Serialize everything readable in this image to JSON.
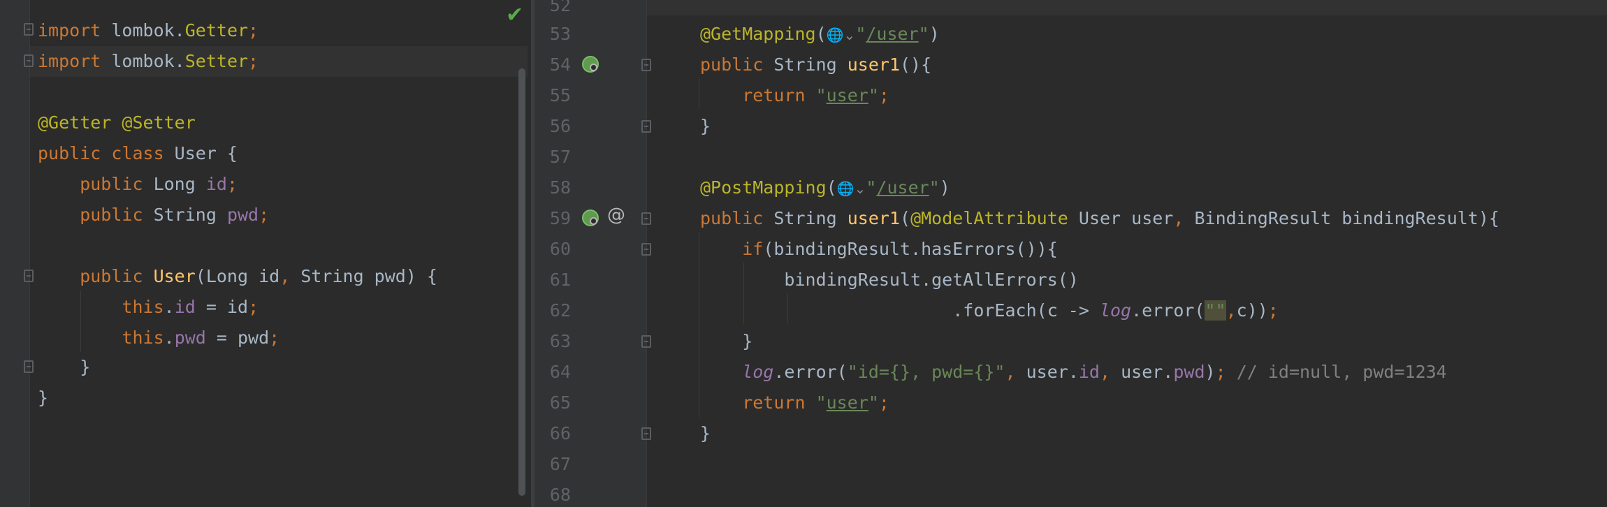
{
  "left_editor": {
    "lines": {
      "l1_kw": "import",
      "l1_pkg": " lombok.",
      "l1_cls": "Getter",
      "l1_semi": ";",
      "l2_kw": "import",
      "l2_pkg": " lombok.",
      "l2_cls": "Setter",
      "l2_semi": ";",
      "l4_ann1": "@Getter",
      "l4_ann2": " @Setter",
      "l5_kw": "public class",
      "l5_name": " User {",
      "l6_kw": "    public",
      "l6_type": " Long ",
      "l6_fld": "id",
      "l6_semi": ";",
      "l7_kw": "    public",
      "l7_type": " String ",
      "l7_fld": "pwd",
      "l7_semi": ";",
      "l9_kw": "    public",
      "l9_fn": " User",
      "l9_p1": "(Long id",
      "l9_comma": ",",
      "l9_p2": " String pwd) {",
      "l10_this": "        this",
      "l10_dot": ".",
      "l10_fld": "id",
      "l10_rest": " = id",
      "l10_semi": ";",
      "l11_this": "        this",
      "l11_dot": ".",
      "l11_fld": "pwd",
      "l11_rest": " = pwd",
      "l11_semi": ";",
      "l12_close": "    }",
      "l13_close": "}"
    }
  },
  "right_editor": {
    "line_numbers": [
      "52",
      "53",
      "54",
      "55",
      "56",
      "57",
      "58",
      "59",
      "60",
      "61",
      "62",
      "63",
      "64",
      "65",
      "66",
      "67",
      "68"
    ],
    "code": {
      "l53_ann": "@GetMapping",
      "l53_open": "(",
      "l53_globe": "🌐⌄",
      "l53_q1": "\"",
      "l53_path": "/user",
      "l53_q2": "\"",
      "l53_close": ")",
      "l54_kw": "public",
      "l54_type": " String ",
      "l54_fn": "user1",
      "l54_rest": "(){",
      "l55_kw": "    return",
      "l55_q1": " \"",
      "l55_val": "user",
      "l55_q2": "\"",
      "l55_semi": ";",
      "l56_close": "}",
      "l58_ann": "@PostMapping",
      "l58_open": "(",
      "l58_globe": "🌐⌄",
      "l58_q1": "\"",
      "l58_path": "/user",
      "l58_q2": "\"",
      "l58_close": ")",
      "l59_kw": "public",
      "l59_type": " String ",
      "l59_fn": "user1",
      "l59_open": "(",
      "l59_ann": "@ModelAttribute",
      "l59_p1": " User user",
      "l59_comma": ",",
      "l59_p2": " BindingResult bindingResult){",
      "l60_kw": "    if",
      "l60_rest": "(bindingResult.hasErrors()){",
      "l61_rest": "        bindingResult.getAllErrors()",
      "l62_pre": "                        .forEach(c -> ",
      "l62_log": "log",
      "l62_mid": ".error(",
      "l62_str": "\"\"",
      "l62_comma": ",",
      "l62_end": "c))",
      "l62_semi": ";",
      "l63_close": "    }",
      "l64_log": "    log",
      "l64_mid": ".error(",
      "l64_str": "\"id={}, pwd={}\"",
      "l64_c1": ",",
      "l64_u1": " user.",
      "l64_f1": "id",
      "l64_c2": ",",
      "l64_u2": " user.",
      "l64_f2": "pwd",
      "l64_close": ")",
      "l64_semi": ";",
      "l64_cmt": " // id=null, pwd=1234",
      "l65_kw": "    return",
      "l65_q1": " \"",
      "l65_val": "user",
      "l65_q2": "\"",
      "l65_semi": ";",
      "l66_close": "}"
    }
  },
  "status": {
    "check_glyph": "✔"
  },
  "colors": {
    "background": "#2b2b2b",
    "gutter": "#313335",
    "keyword": "#cc7832",
    "annotation": "#bbb529",
    "string": "#6a8759",
    "field": "#9876aa",
    "function": "#ffc66d",
    "comment": "#808080",
    "plain": "#a9b7c6",
    "check": "#5aa94d"
  },
  "icons": {
    "gutter_54": "spring-bean-icon",
    "gutter_59": "spring-bean-icon",
    "gutter_59_extra": "at-icon",
    "inline_53": "globe-icon",
    "inline_58": "globe-icon"
  }
}
